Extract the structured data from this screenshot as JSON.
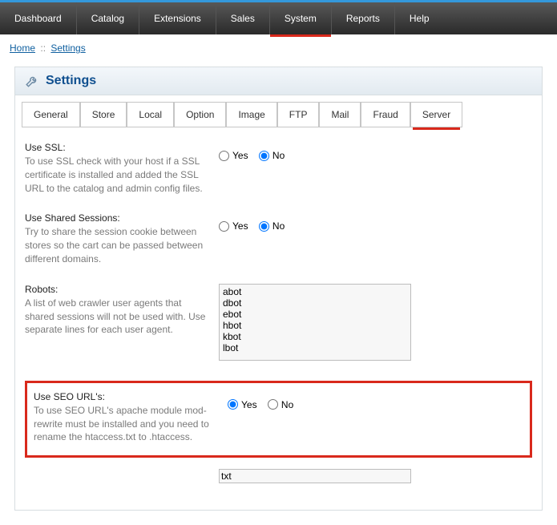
{
  "topnav": {
    "items": [
      "Dashboard",
      "Catalog",
      "Extensions",
      "Sales",
      "System",
      "Reports",
      "Help"
    ],
    "active": "System"
  },
  "breadcrumb": {
    "home": "Home",
    "sep": "::",
    "current": "Settings"
  },
  "panel": {
    "title": "Settings"
  },
  "tabs": {
    "items": [
      "General",
      "Store",
      "Local",
      "Option",
      "Image",
      "FTP",
      "Mail",
      "Fraud",
      "Server"
    ],
    "active": "Server"
  },
  "fields": {
    "ssl": {
      "title": "Use SSL:",
      "desc": "To use SSL check with your host if a SSL certificate is installed and added the SSL URL to the catalog and admin config files.",
      "yes": "Yes",
      "no": "No",
      "value": "No"
    },
    "shared": {
      "title": "Use Shared Sessions:",
      "desc": "Try to share the session cookie between stores so the cart can be passed between different domains.",
      "yes": "Yes",
      "no": "No",
      "value": "No"
    },
    "robots": {
      "title": "Robots:",
      "desc": "A list of web crawler user agents that shared sessions will not be used with. Use separate lines for each user agent.",
      "value": "abot\ndbot\nebot\nhbot\nkbot\nlbot"
    },
    "seo": {
      "title": "Use SEO URL's:",
      "desc": "To use SEO URL's apache module mod-rewrite must be installed and you need to rename the htaccess.txt to .htaccess.",
      "yes": "Yes",
      "no": "No",
      "value": "Yes"
    },
    "extra": {
      "value": "txt"
    }
  }
}
